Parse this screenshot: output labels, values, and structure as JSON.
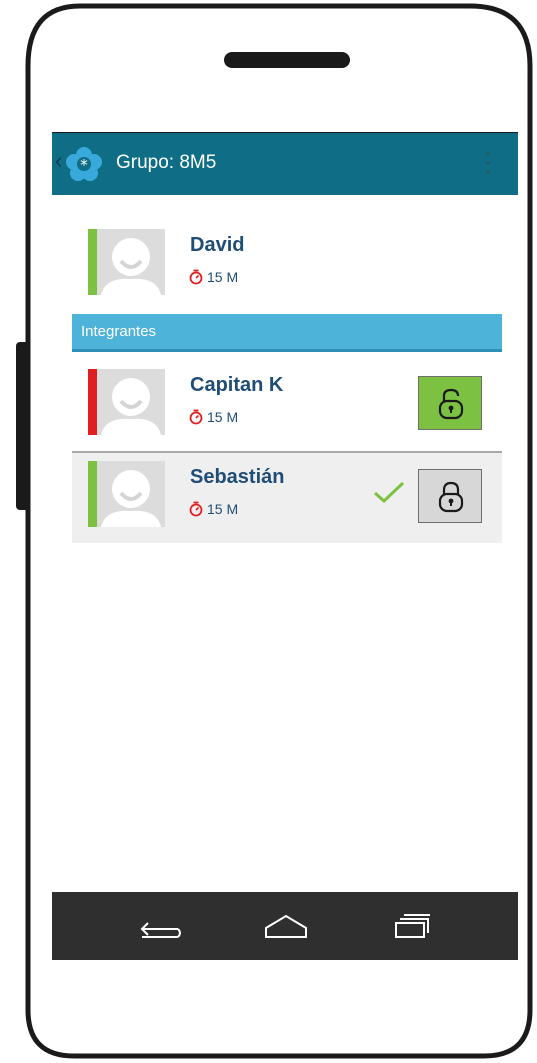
{
  "appbar": {
    "back_glyph": "‹",
    "title": "Grupo: 8M5",
    "logo_icon": "flower-logo-icon",
    "menu_icon": "overflow-menu-icon"
  },
  "current_user": {
    "name": "David",
    "time": "15 M",
    "status_color": "#7cc142"
  },
  "section": {
    "title": "Integrantes"
  },
  "members": [
    {
      "name": "Capitan K",
      "time": "15 M",
      "status_color": "#e02020",
      "lock_state": "unlocked",
      "lock_icon": "unlocked-padlock-icon"
    },
    {
      "name": "Sebastián",
      "time": "15 M",
      "status_color": "#7cc142",
      "lock_state": "locked",
      "lock_icon": "locked-padlock-icon",
      "checked": true
    }
  ],
  "navbar": {
    "back_icon": "back-arrow-icon",
    "home_icon": "home-icon",
    "recents_icon": "recent-apps-icon"
  },
  "colors": {
    "appbar": "#0f6e85",
    "section_header": "#4db3d8",
    "name_text": "#1f4d75",
    "timer_icon": "#e02020",
    "check": "#7cc142",
    "lock_active": "#7cc142",
    "lock_idle": "#d7d7d7",
    "navbar": "#2f2f2f"
  }
}
